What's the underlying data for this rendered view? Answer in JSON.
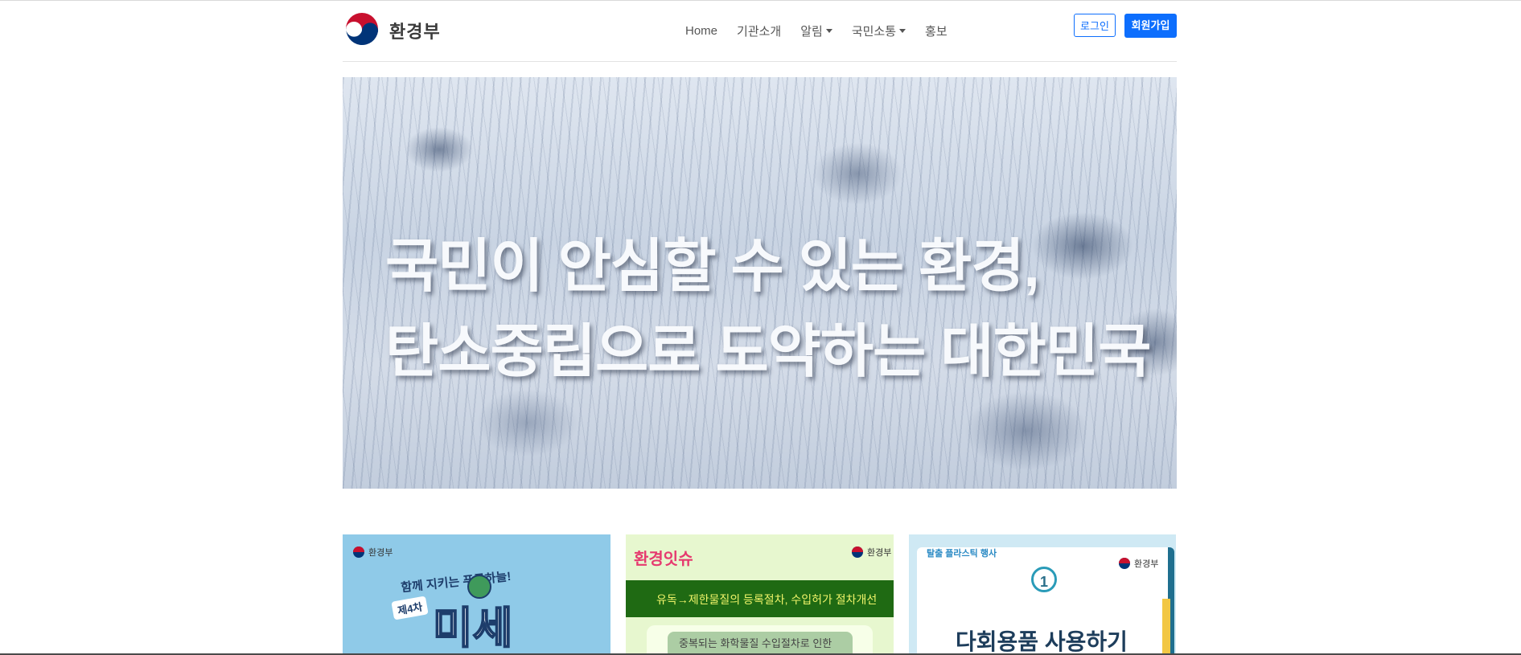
{
  "header": {
    "logo_text": "환경부",
    "nav": [
      {
        "label": "Home",
        "has_caret": false
      },
      {
        "label": "기관소개",
        "has_caret": false
      },
      {
        "label": "알림",
        "has_caret": true
      },
      {
        "label": "국민소통",
        "has_caret": true
      },
      {
        "label": "홍보",
        "has_caret": false
      }
    ],
    "login_label": "로그인",
    "signup_label": "회원가입"
  },
  "hero": {
    "line1": "국민이 안심할 수 있는 환경,",
    "line2": "탄소중립으로 도약하는 대한민국"
  },
  "cards": [
    {
      "org": "환경부",
      "slogan": "함께 지키는 푸른하늘!",
      "badge": "제4차",
      "headline": "미세"
    },
    {
      "series": "환경잇슈",
      "org": "환경부",
      "banner": "유독→제한물질의 등록절차, 수입허가 절차개선",
      "body": "중복되는 화학물질 수입절차로 인한"
    },
    {
      "org": "환경부",
      "tag": "탈출 플라스틱 행사",
      "cycle_number": "1",
      "headline": "다회용품 사용하기"
    }
  ],
  "colors": {
    "primary": "#0d6efd",
    "logo_red": "#c8102e",
    "logo_blue": "#003478"
  }
}
